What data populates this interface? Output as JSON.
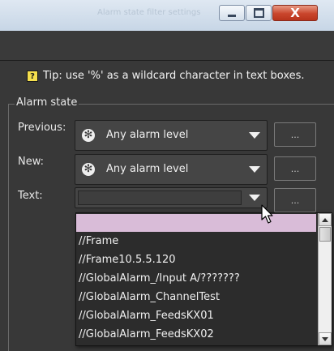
{
  "window": {
    "title": "Alarm state filter settings",
    "minimize_icon": "minimize-icon",
    "maximize_icon": "maximize-icon",
    "close_icon": "close-icon",
    "close_glyph": "X"
  },
  "tip": {
    "icon": "help-icon",
    "icon_glyph": "?",
    "text": "Tip: use '%' as a wildcard character in text boxes."
  },
  "alarm_state": {
    "group_title": "Alarm state",
    "previous": {
      "label": "Previous:",
      "value": "Any alarm level",
      "icon": "asterisk-icon",
      "icon_glyph": "✻",
      "button_label": "..."
    },
    "new": {
      "label": "New:",
      "value": "Any alarm level",
      "icon": "asterisk-icon",
      "icon_glyph": "✻",
      "button_label": "..."
    },
    "text": {
      "label": "Text:",
      "value": "",
      "button_label": "..."
    }
  },
  "dropdown": {
    "items": [
      "",
      "//Frame",
      "//Frame10.5.5.120",
      "//GlobalAlarm_/Input A/???????",
      "//GlobalAlarm_ChannelTest",
      "//GlobalAlarm_FeedsKX01",
      "//GlobalAlarm_FeedsKX02"
    ],
    "highlight_color": "#d9bcd8"
  }
}
